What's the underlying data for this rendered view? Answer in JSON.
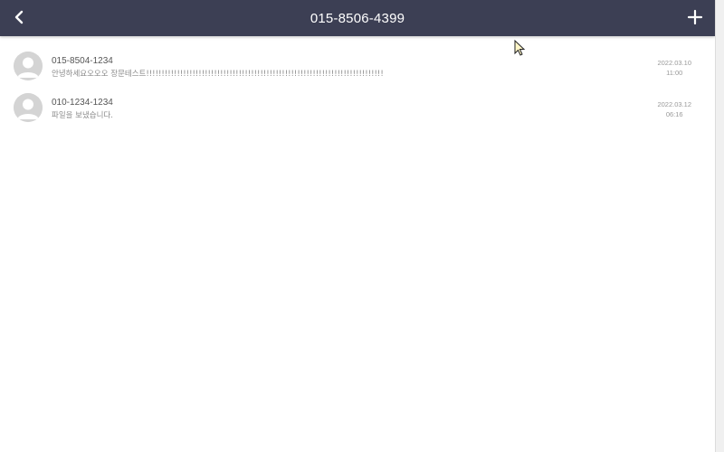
{
  "header": {
    "title": "015-8506-4399",
    "back_icon": "chevron-left-icon",
    "add_icon": "plus-icon",
    "background": "#3c3f54"
  },
  "messages": [
    {
      "sender": "015-8504-1234",
      "preview": "안녕하세요오오오 장문테스트!!!!!!!!!!!!!!!!!!!!!!!!!!!!!!!!!!!!!!!!!!!!!!!!!!!!!!!!!!!!!!!!!!!!!!!!!!!!!",
      "date": "2022.03.10",
      "time": "11:00"
    },
    {
      "sender": "010-1234-1234",
      "preview": "파일을 보냈습니다.",
      "date": "2022.03.12",
      "time": "06:16"
    }
  ]
}
